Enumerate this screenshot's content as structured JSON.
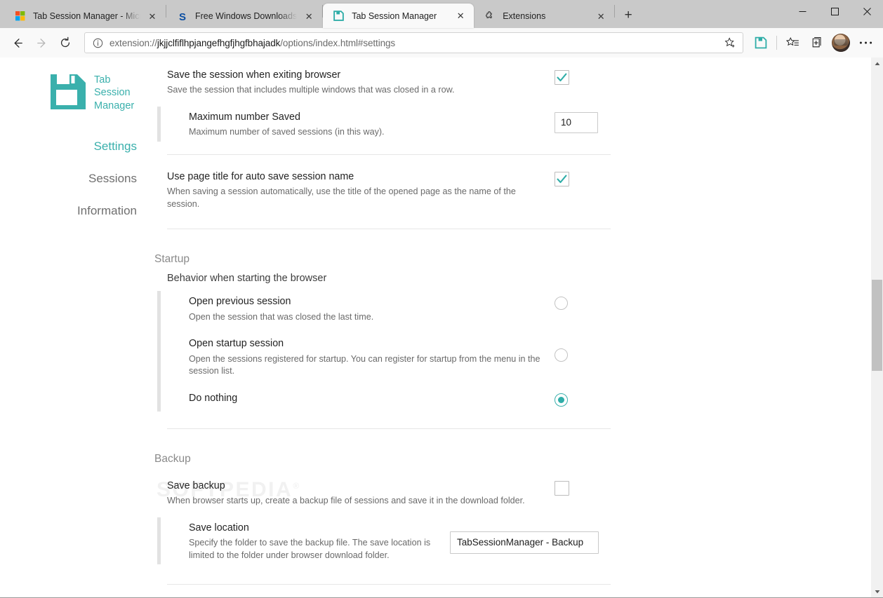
{
  "window": {
    "minimize_label": "Minimize",
    "maximize_label": "Maximize",
    "close_label": "Close"
  },
  "tabs": [
    {
      "title": "Tab Session Manager - Microsoft",
      "icon": "microsoft-logo-icon",
      "active": false
    },
    {
      "title": "Free Windows Downloads",
      "icon": "softpedia-s-icon",
      "active": false
    },
    {
      "title": "Tab Session Manager",
      "icon": "floppy-disk-icon",
      "active": true
    },
    {
      "title": "Extensions",
      "icon": "puzzle-piece-icon",
      "active": false
    }
  ],
  "new_tab_label": "+",
  "close_tab_label": "✕",
  "toolbar": {
    "back_label": "←",
    "forward_label": "→",
    "refresh_label": "↻",
    "url_scheme": "extension://",
    "url_host": "jkjjclfiflhpjangefhgfjhgfbhajadk",
    "url_path": "/options/index.html#settings",
    "url_full": "extension://jkjjclfiflhpjangefhgfjhgfbhajadk/options/index.html#settings",
    "icons": {
      "favorite": "star-add-icon",
      "extension": "floppy-disk-extension-icon",
      "favorites_list": "favorites-star-list-icon",
      "collections": "collections-add-icon",
      "profile": "profile-avatar",
      "settings_more": "ellipsis-more-icon"
    }
  },
  "sidebar": {
    "logo_icon": "floppy-disk-logo-icon",
    "brand_lines": [
      "Tab",
      "Session",
      "Manager"
    ],
    "brand_color": "#3ab0ac",
    "items": [
      {
        "label": "Settings",
        "active": true
      },
      {
        "label": "Sessions",
        "active": false
      },
      {
        "label": "Information",
        "active": false
      }
    ]
  },
  "watermark": {
    "text": "SOFTPEDIA",
    "mark": "®"
  },
  "settings": {
    "exit_save": {
      "title": "Save the session when exiting browser",
      "desc": "Save the session that includes multiple windows that was closed in a row.",
      "checked": true,
      "sub": {
        "title": "Maximum number Saved",
        "desc": "Maximum number of saved sessions (in this way).",
        "value": "10"
      }
    },
    "page_title": {
      "title": "Use page title for auto save session name",
      "desc": "When saving a session automatically, use the title of the opened page as the name of the session.",
      "checked": true
    },
    "startup": {
      "section": "Startup",
      "group": "Behavior when starting the browser",
      "options": [
        {
          "title": "Open previous session",
          "desc": "Open the session that was closed the last time.",
          "selected": false
        },
        {
          "title": "Open startup session",
          "desc": "Open the sessions registered for startup. You can register for startup from the menu in the session list.",
          "selected": false
        },
        {
          "title": "Do nothing",
          "desc": "",
          "selected": true
        }
      ]
    },
    "backup": {
      "section": "Backup",
      "save_backup": {
        "title": "Save backup",
        "desc": "When browser starts up, create a backup file of sessions and save it in the download folder.",
        "checked": false
      },
      "save_location": {
        "title": "Save location",
        "desc": "Specify the folder to save the backup file. The save location is limited to the folder under browser download folder.",
        "value": "TabSessionManager - Backup"
      }
    }
  }
}
